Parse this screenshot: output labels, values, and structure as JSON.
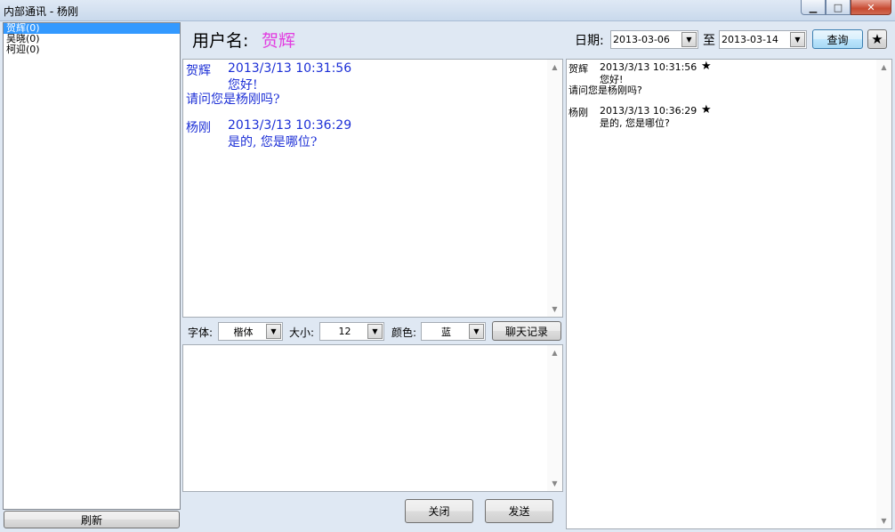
{
  "window": {
    "title": "内部通讯 - 杨刚",
    "minimize_glyph": "▁",
    "maximize_glyph": "□",
    "close_glyph": "✕"
  },
  "contacts": [
    {
      "label": "贺辉(0)",
      "selected": true
    },
    {
      "label": "吴晓(0)",
      "selected": false
    },
    {
      "label": "柯迎(0)",
      "selected": false
    }
  ],
  "refresh_label": "刷新",
  "header": {
    "user_label": "用户名:",
    "user_name": "贺辉",
    "date_label": "日期:",
    "start_date": "2013-03-06",
    "to_label": "至",
    "end_date": "2013-03-14",
    "query_label": "查询",
    "star_glyph": "★"
  },
  "conversation": [
    {
      "sender": "贺辉",
      "time": "2013/3/13 10:31:56",
      "lines": [
        "您好!",
        "请问您是杨刚吗?"
      ]
    },
    {
      "sender": "杨刚",
      "time": "2013/3/13 10:36:29",
      "lines": [
        "是的, 您是哪位?"
      ]
    }
  ],
  "toolbar": {
    "font_label": "字体:",
    "font_value": "楷体",
    "size_label": "大小:",
    "size_value": "12",
    "color_label": "颜色:",
    "color_value": "蓝",
    "history_label": "聊天记录"
  },
  "actions": {
    "close_label": "关闭",
    "send_label": "发送"
  },
  "history": [
    {
      "sender": "贺辉",
      "time": "2013/3/13 10:31:56",
      "star": "★",
      "lines": [
        "您好!",
        "请问您是杨刚吗?"
      ]
    },
    {
      "sender": "杨刚",
      "time": "2013/3/13 10:36:29",
      "star": "★",
      "lines": [
        "是的, 您是哪位?"
      ]
    }
  ],
  "colors": {
    "username": "#e23ce0",
    "chat_text": "#1c2fd6",
    "selection": "#3399ff"
  }
}
